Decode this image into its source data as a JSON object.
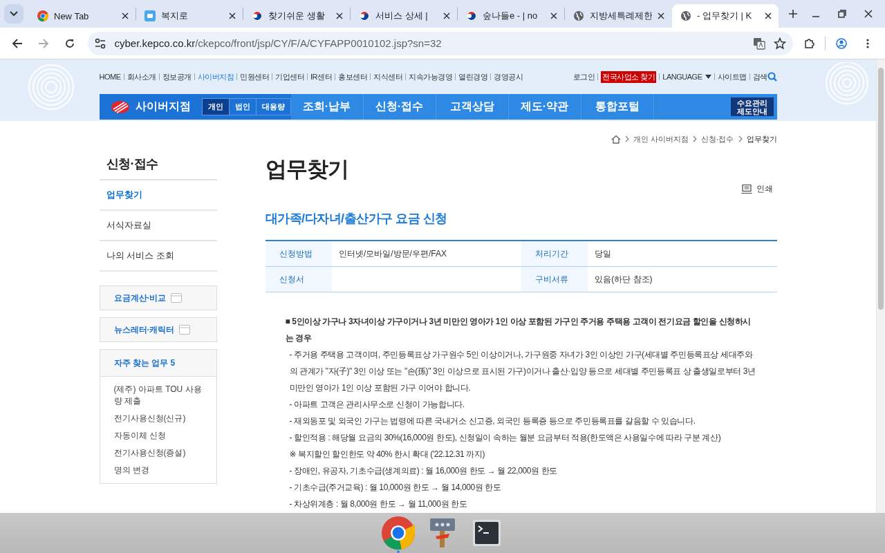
{
  "browser": {
    "tabs": [
      {
        "title": "New Tab",
        "kind": "chrome",
        "selected": false
      },
      {
        "title": "복지로",
        "kind": "app",
        "selected": false
      },
      {
        "title": "찾기쉬운 생활",
        "kind": "taegeuk",
        "selected": false
      },
      {
        "title": "서비스 상세 | ",
        "kind": "taegeuk",
        "selected": false
      },
      {
        "title": "숲나들e - | no",
        "kind": "taegeuk",
        "selected": false
      },
      {
        "title": "지방세특례제한",
        "kind": "globe",
        "selected": false
      },
      {
        "title": "- 업무찾기 | K",
        "kind": "globe",
        "selected": true
      }
    ],
    "url": {
      "host": "cyber.kepco.co.kr",
      "path": "/ckepco/front/jsp/CY/F/A/CYFAPP0010102.jsp?sn=32"
    }
  },
  "site": {
    "util_links": [
      {
        "label": "HOME",
        "selected": false
      },
      {
        "label": "회사소개",
        "selected": false
      },
      {
        "label": "정보공개",
        "selected": false
      },
      {
        "label": "사이버지점",
        "selected": true
      },
      {
        "label": "민원센터",
        "selected": false
      },
      {
        "label": "기업센터",
        "selected": false
      },
      {
        "label": "IR센터",
        "selected": false
      },
      {
        "label": "홍보센터",
        "selected": false
      },
      {
        "label": "지식센터",
        "selected": false
      },
      {
        "label": "지속가능경영",
        "selected": false
      },
      {
        "label": "열린경영",
        "selected": false
      },
      {
        "label": "경영공시",
        "selected": false
      }
    ],
    "util_right": [
      {
        "label": "로그인",
        "kind": "link"
      },
      {
        "label": "전국사업소 찾기",
        "kind": "highlight"
      },
      {
        "label": "LANGUAGE",
        "kind": "dropdown"
      },
      {
        "label": "사이트맵",
        "kind": "link"
      },
      {
        "label": "검색",
        "kind": "search"
      }
    ],
    "nav": {
      "brand": "사이버지점",
      "segments": [
        {
          "label": "개인",
          "selected": true
        },
        {
          "label": "법인",
          "selected": false
        },
        {
          "label": "대용량",
          "selected": false
        }
      ],
      "menu": [
        "조회·납부",
        "신청·접수",
        "고객상담",
        "제도·약관",
        "통합포털"
      ],
      "side_button": [
        "수요관리",
        "제도안내"
      ]
    }
  },
  "breadcrumb": [
    "개인 사이버지점",
    "신청·접수",
    "업무찾기"
  ],
  "sidebar": {
    "title": "신청·접수",
    "items": [
      {
        "label": "업무찾기",
        "selected": true
      },
      {
        "label": "서식자료실",
        "selected": false
      },
      {
        "label": "나의 서비스 조회",
        "selected": false
      }
    ],
    "boxes": [
      "요금계산·비교",
      "뉴스레터·캐릭터"
    ],
    "frequent": {
      "title": "자주 찾는 업무 5",
      "items": [
        "(제주) 아파트 TOU 사용량 제출",
        "전기사용신청(신규)",
        "자동이체 신청",
        "전기사용신청(증설)",
        "명의 변경"
      ]
    }
  },
  "main": {
    "title": "업무찾기",
    "print": "인쇄",
    "subtitle": "대가족/다자녀/출산가구 요금 신청",
    "info": [
      [
        {
          "label": "신청방법",
          "value": "인터넷/모바일/방문/우편/FAX"
        },
        {
          "label": "처리기간",
          "value": "당일"
        }
      ],
      [
        {
          "label": "신청서"
        },
        {
          "label": "구비서류",
          "value": "있음(하단 참조)"
        }
      ]
    ],
    "content": [
      {
        "kind": "heading",
        "text": "■ 5인이상 가구나 3자녀이상 가구이거나 3년 미만인 영아가 1인 이상 포함된 가구인 주거용 주택용 고객이 전기요금 할인을 신청하시는 경우"
      },
      {
        "kind": "item",
        "text": "- 주거용 주택용 고객이며, 주민등록표상 가구원수 5인 이상이거나, 가구원중 자녀가 3인 이상인 가구(세대별 주민등록표상 세대주와의 관계가 \"자(子)\" 3인 이상 또는 \"손(孫)\" 3인 이상으로 표시된 가구)이거나 출산·입양 등으로 세대별 주민등록표 상 출생일로부터 3년 미만인 영아가 1인 이상 포함된 가구 이어야 합니다."
      },
      {
        "kind": "item",
        "text": "- 아파트 고객은 관리사무소로 신청이 가능합니다."
      },
      {
        "kind": "item",
        "text": "- 재외동포 및 외국인 가구는 법령에 따른 국내거소 신고증, 외국인 등록증 등으로 주민등록표를 갈음할 수 있습니다."
      },
      {
        "kind": "item",
        "text": "- 할인적용 : 해당월 요금의 30%(16,000원 한도), 신청일이 속하는 월분 요금부터 적용(한도액은 사용일수에 따라 구분 계산)"
      },
      {
        "kind": "item",
        "text": "※ 복지할인 할인한도 약 40% 한시 확대 ('22.12.31 까지)"
      },
      {
        "kind": "item",
        "text": "- 장애인, 유공자, 기초수급(생계의료) : 월 16,000원 한도 → 월 22,000원 한도"
      },
      {
        "kind": "item",
        "text": "- 기초수급(주거교육) : 월 10,000원 한도 → 월 14,000원 한도"
      },
      {
        "kind": "item",
        "text": "- 차상위계층 : 월 8,000원 한도 → 월 11,000원 한도"
      }
    ]
  },
  "taskbar": [
    {
      "kind": "chrome",
      "running": true
    },
    {
      "kind": "tool",
      "running": false
    },
    {
      "kind": "terminal",
      "running": false
    }
  ]
}
